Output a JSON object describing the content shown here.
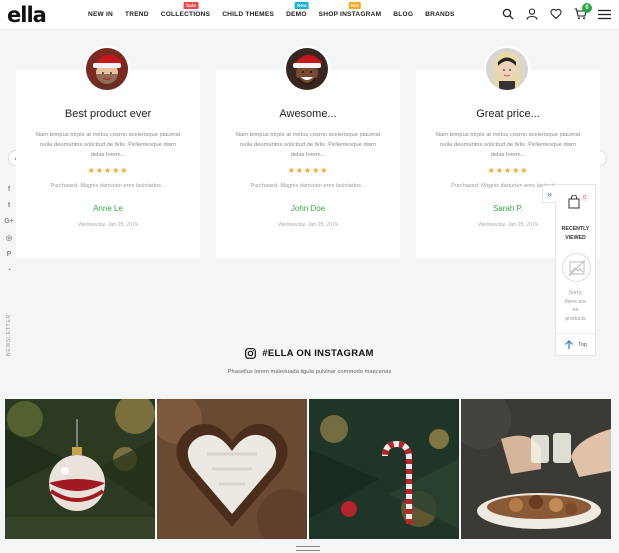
{
  "brand": {
    "logo": "ella"
  },
  "nav": {
    "items": [
      {
        "label": "NEW IN"
      },
      {
        "label": "TREND"
      },
      {
        "label": "COLLECTIONS",
        "badge": "Sale",
        "badge_color": "#e94b4b"
      },
      {
        "label": "CHILD THEMES"
      },
      {
        "label": "DEMO",
        "badge": "New",
        "badge_color": "#1ab0d8"
      },
      {
        "label": "SHOP INSTAGRAM",
        "badge": "Hot",
        "badge_color": "#f5a623"
      },
      {
        "label": "BLOG"
      },
      {
        "label": "BRANDS"
      }
    ]
  },
  "header_icons": {
    "cart_count": "0",
    "icons": [
      "search-icon",
      "user-icon",
      "heart-icon",
      "cart-icon",
      "menu-icon"
    ]
  },
  "social": {
    "icons": [
      "facebook-icon",
      "twitter-icon",
      "google-plus-icon",
      "instagram-icon",
      "pinterest-icon",
      "snapchat-icon"
    ],
    "glyphs": [
      "f",
      "t",
      "G+",
      "◎",
      "P",
      "◔"
    ]
  },
  "newsletter": {
    "label": "NEWSLETTER"
  },
  "testimonials": [
    {
      "title": "Best product ever",
      "text": "Nam tempus turpis at metus cosmo scelerisque placerat nulla deumantos solicitud de felis. Pellentesque diam delas lorem...",
      "stars": "★★★★★",
      "purchased": "Purchased: Magnis darturien eres laciniados...",
      "author": "Anne Le",
      "date": "Wednesday, Jan 25, 2019"
    },
    {
      "title": "Awesome...",
      "text": "Nam tempus turpis at metus cosmo scelerisque placerat nulla deumantos solicitud de felis. Pellentesque diam delas lorem...",
      "stars": "★★★★★",
      "purchased": "Purchased: Magnis darturien eres laciniados...",
      "author": "John Doe",
      "date": "Wednesday, Jan 25, 2019"
    },
    {
      "title": "Great price...",
      "text": "Nam tempus turpis at metus cosmo scelerisque placerat nulla deumantos solicitud de felis. Pellentesque diam delas lorem...",
      "stars": "★★★★★",
      "purchased": "Purchased: Magnis darturien eres lacinados...",
      "author": "Sarah P.",
      "date": "Wednesday, Jan 25, 2019"
    }
  ],
  "carousel": {
    "prev": "‹",
    "next": "›"
  },
  "recently_viewed": {
    "toggle": "»",
    "count": "0",
    "title_line1": "RECENTLY",
    "title_line2": "VIEWED",
    "empty_lines": [
      "Sorry,",
      "there are",
      "no",
      "products"
    ],
    "top_label": "Top"
  },
  "instagram": {
    "title": "#ELLA ON INSTAGRAM",
    "subtitle": "Phasellus lorem malesuada ligula pulvinar commodo maecenas"
  },
  "colors": {
    "accent_green": "#3aa845",
    "star": "#f5a623",
    "link_blue": "#3478c6"
  }
}
